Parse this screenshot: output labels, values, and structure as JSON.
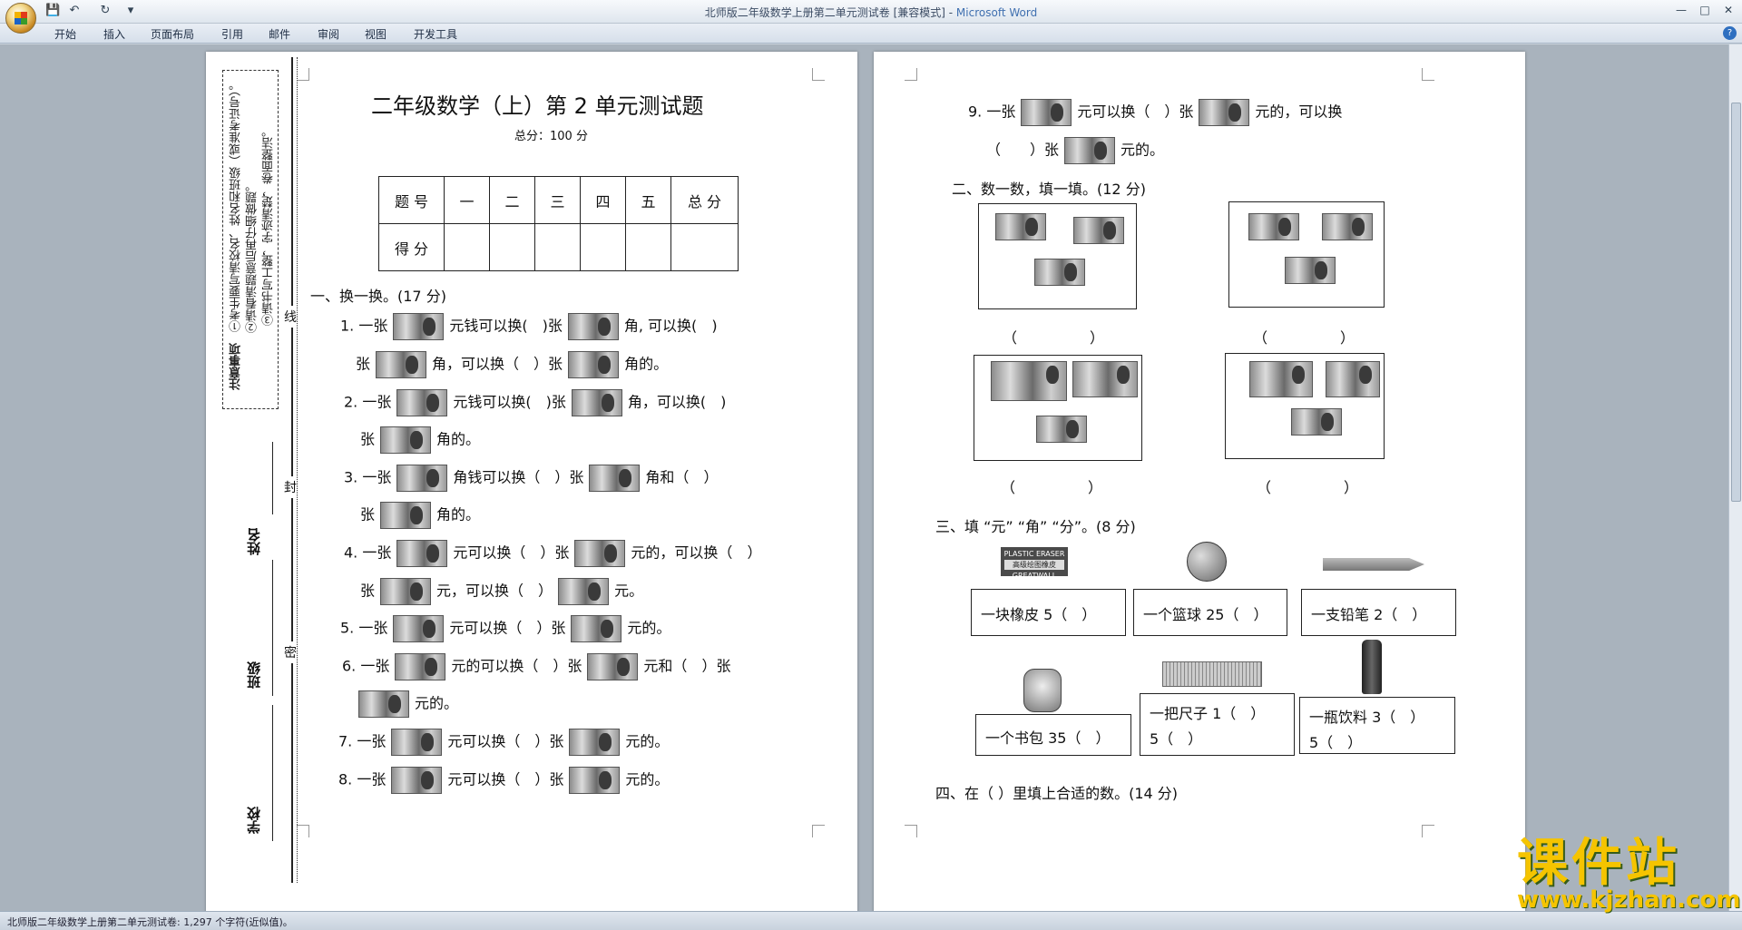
{
  "window": {
    "title": "北师版二年级数学上册第二单元测试卷 [兼容模式] - Microsoft Word",
    "title_doc": "北师版二年级数学上册第二单元测试卷 [兼容模式] - ",
    "title_app": "Microsoft Word"
  },
  "ribbon": {
    "tabs": [
      "开始",
      "插入",
      "页面布局",
      "引用",
      "邮件",
      "审阅",
      "视图",
      "开发工具"
    ]
  },
  "page1": {
    "notice_title": "注意事项",
    "notice_lines": [
      "①考生要写清校名、姓名和班级（或准考证号）。",
      "②请看清题意后再仔细做题。",
      "③请书写工整，字迹清楚，卷面整洁。"
    ],
    "binding": [
      "线",
      "封",
      "密"
    ],
    "fields": [
      "姓名",
      "班级",
      "学校"
    ],
    "title": "二年级数学（上）第 2 单元测试题",
    "total": "总分：100 分",
    "table_header": [
      "题 号",
      "一",
      "二",
      "三",
      "四",
      "五",
      "总 分"
    ],
    "table_row_label": "得 分",
    "section1": "一、换一换。(17 分)",
    "q": [
      {
        "a": "1. 一张",
        "b": "元钱可以换(",
        "c": ")张",
        "d": "角, 可以换(",
        "e": ")"
      },
      {
        "a": "张",
        "b": "角，可以换（",
        "c": "）张",
        "d": "角的。"
      },
      {
        "a": "2. 一张",
        "b": "元钱可以换(",
        "c": ")张",
        "d": "角，可以换(",
        "e": ")"
      },
      {
        "a": "张",
        "b": "角的。"
      },
      {
        "a": "3. 一张",
        "b": "角钱可以换（",
        "c": "）张",
        "d": "角和（",
        "e": "）"
      },
      {
        "a": "张",
        "b": "角的。"
      },
      {
        "a": "4. 一张",
        "b": "元可以换（",
        "c": "）张",
        "d": "元的，可以换（",
        "e": "）"
      },
      {
        "a": "张",
        "b": "元，可以换（",
        "c": "）",
        "d": "元。"
      },
      {
        "a": "5. 一张",
        "b": "元可以换（",
        "c": "）张",
        "d": "元的。"
      },
      {
        "a": "6. 一张",
        "b": "元的可以换（",
        "c": "）张",
        "d": "元和（",
        "e": "）张"
      },
      {
        "a": "元的。"
      },
      {
        "a": "7. 一张",
        "b": "元可以换（",
        "c": "）张",
        "d": "元的。"
      },
      {
        "a": "8. 一张",
        "b": "元可以换（",
        "c": "）张",
        "d": "元的。"
      }
    ]
  },
  "page2": {
    "q9_line1": [
      "9. 一张",
      "元可以换（",
      "）张",
      "元的，可以换"
    ],
    "q9_line2": [
      "（",
      "）张",
      "元的。"
    ],
    "section2": "二、数一数，填一填。(12 分)",
    "blank": [
      "（",
      "）"
    ],
    "section3": "三、填 “元” “角” “分”。(8 分)",
    "eraser_label": "PLASTIC ERASER",
    "eraser_sub": "高级绘图橡皮",
    "eraser_brand": "GREATWALL",
    "items": [
      "一块橡皮 5（　）",
      "一个篮球 25（　）",
      "一支铅笔 2（　）",
      "一个书包 35（　）",
      "一把尺子 1（　）",
      "5（　）",
      "一瓶饮料 3（　）",
      "5（　）"
    ],
    "section4": "四、在（ ）里填上合适的数。(14 分)"
  },
  "status": {
    "text": "北师版二年级数学上册第二单元测试卷: 1,297 个字符(近似值)。"
  },
  "watermark": {
    "main": "课件站",
    "url": "www.kjzhan.com"
  }
}
